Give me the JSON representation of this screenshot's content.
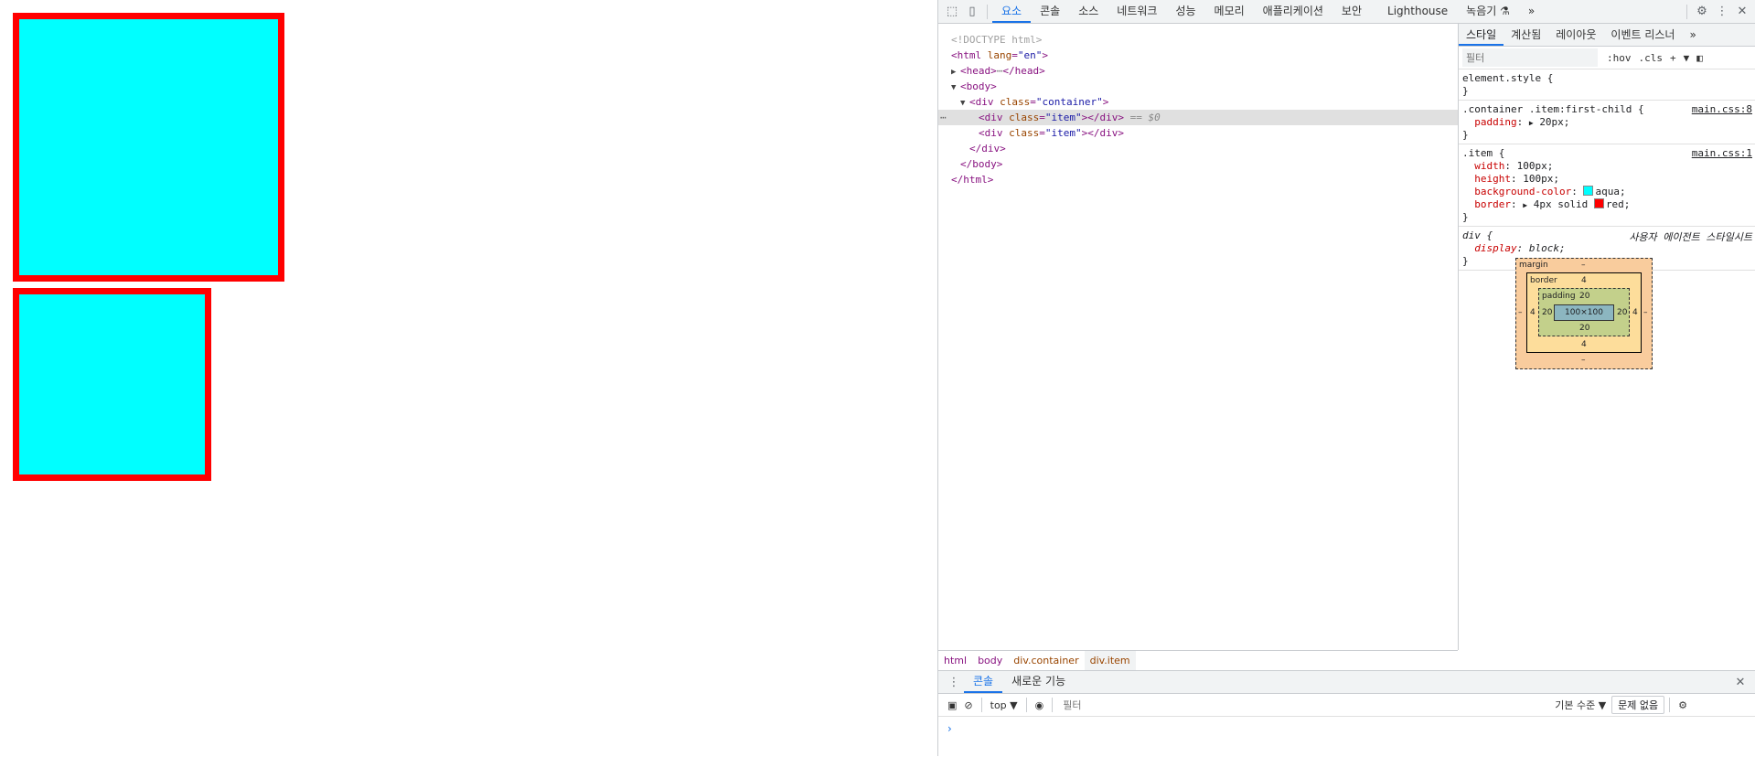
{
  "devtools": {
    "tabs": [
      "요소",
      "콘솔",
      "소스",
      "네트워크",
      "성능",
      "메모리",
      "애플리케이션",
      "보안",
      "Lighthouse",
      "녹음기 ⚗"
    ],
    "active_tab": "요소",
    "more_tabs": "»",
    "icons": [
      "inspect-icon",
      "device-icon",
      "gear-icon",
      "kebab-menu-icon",
      "close-icon"
    ]
  },
  "dom": {
    "doctype": "<!DOCTYPE html>",
    "html_open_tag": "html",
    "html_lang_attr": "lang",
    "html_lang_val": "\"en\"",
    "head_tag": "head",
    "body_tag": "body",
    "div_tag": "div",
    "class_attr": "class",
    "container_val": "\"container\"",
    "item_val": "\"item\"",
    "selected_suffix": "== $0"
  },
  "breadcrumb": [
    "html",
    "body",
    "div.container",
    "div.item"
  ],
  "styles": {
    "subtabs": [
      "스타일",
      "계산됨",
      "레이아웃",
      "이벤트 리스너",
      "»"
    ],
    "filter_placeholder": "필터",
    "hov": ":hov",
    "cls": ".cls",
    "rules": {
      "element_style": "element.style {",
      "r1_selector": ".container .item:first-child {",
      "r1_src": "main.css:8",
      "r1_prop": "padding",
      "r1_val": "20px;",
      "r2_selector": ".item {",
      "r2_src": "main.css:1",
      "width_prop": "width",
      "width_val": "100px;",
      "height_prop": "height",
      "height_val": "100px;",
      "bg_prop": "background-color",
      "bg_val": "aqua;",
      "border_prop": "border",
      "border_val_pre": "4px solid",
      "border_val_color": "red;",
      "r3_selector": "div {",
      "r3_src": "사용자 에이전트 스타일시트",
      "display_prop": "display",
      "display_val": "block;",
      "close": "}"
    },
    "colors": {
      "aqua": "#00ffff",
      "red": "#ff0000"
    }
  },
  "box_model": {
    "margin_label": "margin",
    "margin_val": "–",
    "border_label": "border",
    "border_val": "4",
    "padding_label": "padding",
    "padding_val": "20",
    "content": "100×100"
  },
  "drawer": {
    "tabs": [
      "콘솔",
      "새로운 기능"
    ],
    "context": "top ▼",
    "filter_placeholder": "필터",
    "level": "기본 수준 ▼",
    "issues": "문제 없음",
    "prompt": "›"
  }
}
